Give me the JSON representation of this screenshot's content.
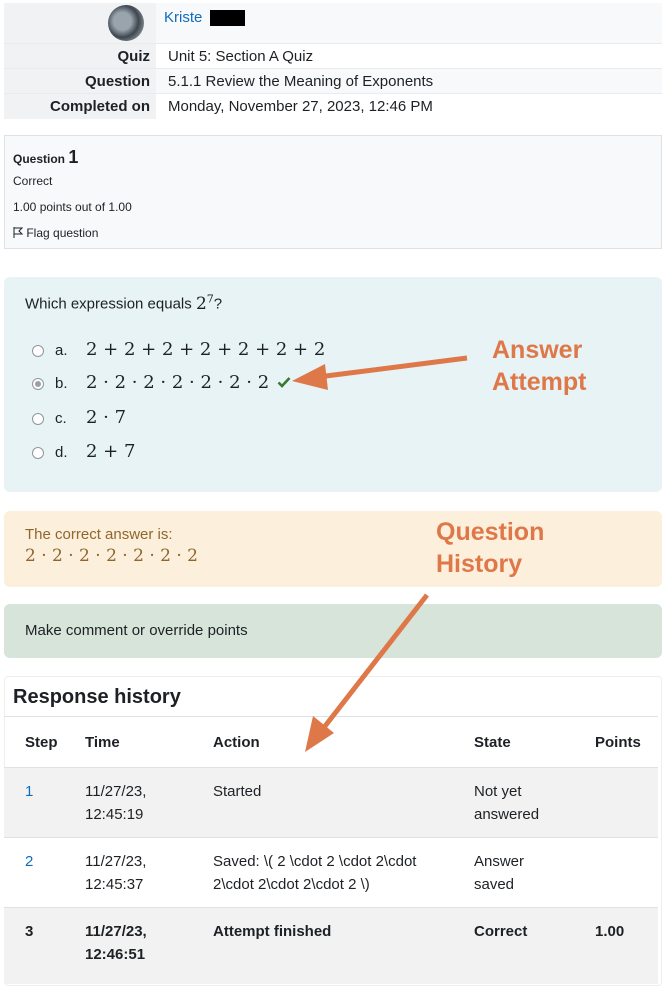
{
  "summary": {
    "user_name": "Kriste",
    "rows": [
      {
        "label": "Quiz",
        "value": "Unit 5: Section A Quiz"
      },
      {
        "label": "Question",
        "value": "5.1.1 Review the Meaning of Exponents"
      },
      {
        "label": "Completed on",
        "value": "Monday, November 27, 2023, 12:46 PM"
      }
    ]
  },
  "question_info": {
    "label": "Question",
    "number": "1",
    "status": "Correct",
    "points": "1.00 points out of 1.00",
    "flag_label": "Flag question"
  },
  "question": {
    "prompt": "Which expression equals",
    "base": "2",
    "exponent": "7",
    "suffix": "?",
    "options": [
      {
        "letter": "a.",
        "expr": "2 + 2 + 2 + 2 + 2 + 2 + 2",
        "selected": false,
        "correct": false
      },
      {
        "letter": "b.",
        "expr": "2 · 2 · 2 · 2 · 2 · 2 · 2",
        "selected": true,
        "correct": true
      },
      {
        "letter": "c.",
        "expr": "2 · 7",
        "selected": false,
        "correct": false
      },
      {
        "letter": "d.",
        "expr": "2 + 7",
        "selected": false,
        "correct": false
      }
    ]
  },
  "feedback": {
    "label": "The correct answer is:",
    "answer": "2 · 2 · 2 · 2 · 2 · 2 · 2"
  },
  "comment_link": "Make comment or override points",
  "annotations": {
    "answer_attempt_line1": "Answer",
    "answer_attempt_line2": "Attempt",
    "question_history_line1": "Question",
    "question_history_line2": "History",
    "color": "#de7849"
  },
  "history": {
    "title": "Response history",
    "headers": [
      "Step",
      "Time",
      "Action",
      "State",
      "Points"
    ],
    "rows": [
      {
        "step": "1",
        "time1": "11/27/23,",
        "time2": "12:45:19",
        "action1": "Started",
        "action2": "",
        "state1": "Not yet",
        "state2": "answered",
        "points": ""
      },
      {
        "step": "2",
        "time1": "11/27/23,",
        "time2": "12:45:37",
        "action1": "Saved: \\( 2 \\cdot 2 \\cdot 2\\cdot",
        "action2": "2\\cdot 2\\cdot 2\\cdot 2 \\)",
        "state1": "Answer",
        "state2": "saved",
        "points": ""
      },
      {
        "step": "3",
        "time1": "11/27/23,",
        "time2": "12:46:51",
        "action1": "Attempt finished",
        "action2": "",
        "state1": "Correct",
        "state2": "",
        "points": "1.00"
      }
    ]
  }
}
